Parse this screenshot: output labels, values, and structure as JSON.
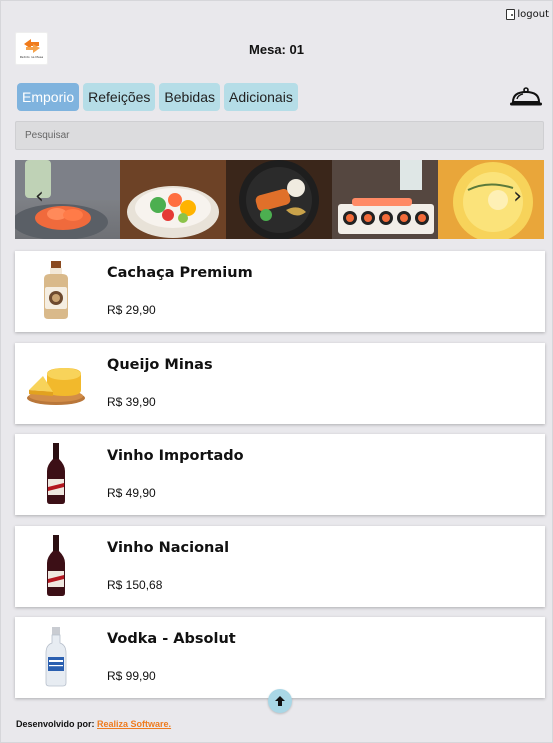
{
  "header": {
    "logout_label": "logout",
    "mesa_label": "Mesa: 01",
    "logo_text": "Pedido na Mesa"
  },
  "tabs": [
    {
      "label": "Emporio",
      "active": true
    },
    {
      "label": "Refeições",
      "active": false
    },
    {
      "label": "Bebidas",
      "active": false
    },
    {
      "label": "Adicionais",
      "active": false
    }
  ],
  "search": {
    "placeholder": "Pesquisar",
    "value": ""
  },
  "carousel": {
    "prev_label": "‹",
    "next_label": "›",
    "slides": [
      "salmon-sashimi-drink",
      "poke-bowl",
      "grilled-salmon-plate",
      "sushi-platter",
      "yellow-drink"
    ]
  },
  "products": [
    {
      "name": "Cachaça Premium",
      "price": "R$ 29,90",
      "icon": "bottle-icon"
    },
    {
      "name": "Queijo Minas",
      "price": "R$ 39,90",
      "icon": "cheese-icon"
    },
    {
      "name": "Vinho Importado",
      "price": "R$ 49,90",
      "icon": "wine-bottle-icon"
    },
    {
      "name": "Vinho Nacional",
      "price": "R$ 150,68",
      "icon": "wine-bottle-icon"
    },
    {
      "name": "Vodka - Absolut",
      "price": "R$ 99,90",
      "icon": "vodka-bottle-icon"
    }
  ],
  "footer": {
    "prefix": "Desenvolvido por:",
    "link": "Realiza Software."
  },
  "colors": {
    "background": "#e9e8ec",
    "tab": "#b5dde7",
    "tab_active": "#7fb3de",
    "brand_orange": "#ee7b1f",
    "scroll_button": "#a9d7e6"
  }
}
